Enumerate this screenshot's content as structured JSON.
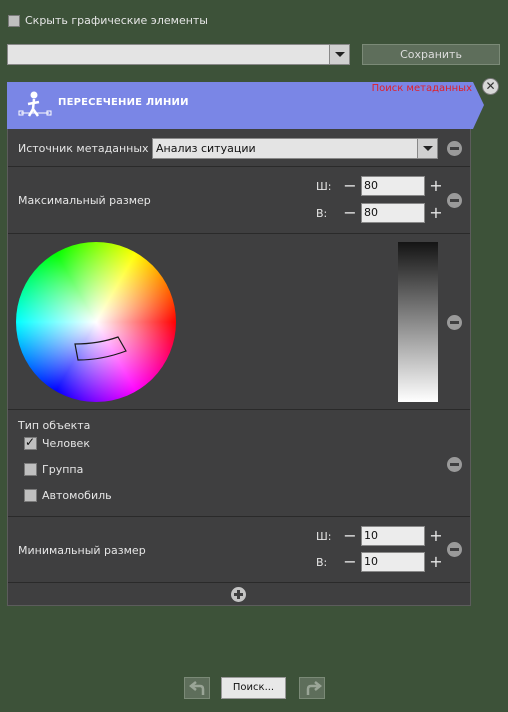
{
  "top": {
    "hide_graphics_label": "Скрыть графические элементы",
    "hide_graphics_checked": false,
    "preset_value": "",
    "save_label": "Сохранить"
  },
  "header": {
    "title": "ПЕРЕСЕЧЕНИЕ ЛИНИИ",
    "meta_search": "Поиск метаданных",
    "accent": "#7a86e6"
  },
  "source": {
    "label": "Источник метаданных",
    "value": "Анализ ситуации"
  },
  "max_size": {
    "label": "Максимальный размер",
    "w_label": "Ш:",
    "h_label": "В:",
    "w_value": "80",
    "h_value": "80"
  },
  "color": {
    "wheel_icon": "color-wheel",
    "brightness_icon": "brightness-gradient"
  },
  "object_type": {
    "label": "Тип объекта",
    "options": [
      {
        "label": "Человек",
        "checked": true
      },
      {
        "label": "Группа",
        "checked": false
      },
      {
        "label": "Автомобиль",
        "checked": false
      }
    ]
  },
  "min_size": {
    "label": "Минимальный размер",
    "w_label": "Ш:",
    "h_label": "В:",
    "w_value": "10",
    "h_value": "10"
  },
  "bottom": {
    "search_label": "Поиск..."
  }
}
